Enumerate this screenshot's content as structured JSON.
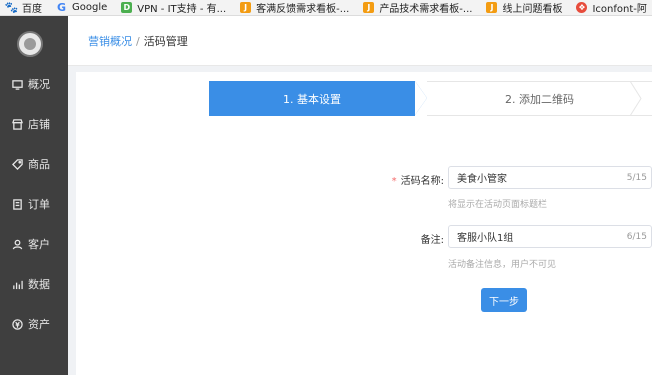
{
  "bookmarks": [
    {
      "icon": "paw-icon",
      "label": "百度"
    },
    {
      "icon": "google-icon",
      "label": "Google"
    },
    {
      "icon": "d-icon",
      "label": "VPN - IT支持 - 有..."
    },
    {
      "icon": "j-icon",
      "label": "客满反馈需求看板-..."
    },
    {
      "icon": "j-icon",
      "label": "产品技术需求看板-..."
    },
    {
      "icon": "j-icon",
      "label": "线上问题看板"
    },
    {
      "icon": "iconfont-icon",
      "label": "Iconfont-阿"
    }
  ],
  "sidebar": {
    "items": [
      {
        "icon": "overview-icon",
        "label": "概况"
      },
      {
        "icon": "store-icon",
        "label": "店铺"
      },
      {
        "icon": "tag-icon",
        "label": "商品"
      },
      {
        "icon": "order-icon",
        "label": "订单"
      },
      {
        "icon": "user-icon",
        "label": "客户"
      },
      {
        "icon": "chart-icon",
        "label": "数据"
      },
      {
        "icon": "asset-icon",
        "label": "资产"
      }
    ]
  },
  "breadcrumb": {
    "parent": "营销概况",
    "separator": "/",
    "current": "活码管理"
  },
  "steps": [
    {
      "label": "1. 基本设置",
      "active": true
    },
    {
      "label": "2. 添加二维码",
      "active": false
    }
  ],
  "form": {
    "name": {
      "required_mark": "*",
      "label": "活码名称:",
      "value": "美食小管家",
      "counter": "5/15",
      "hint": "将显示在活动页面标题栏"
    },
    "remark": {
      "label": "备注:",
      "value": "客服小队1组",
      "counter": "6/15",
      "hint": "活动备注信息，用户不可见"
    },
    "next_button": "下一步"
  },
  "colors": {
    "accent": "#3a8ee6",
    "sidebar": "#3f3f3f",
    "required": "#f56c6c"
  }
}
